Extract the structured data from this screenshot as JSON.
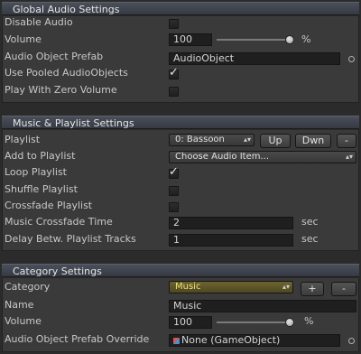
{
  "global": {
    "title": "Global Audio Settings",
    "disable_audio_label": "Disable Audio",
    "disable_audio_checked": false,
    "volume_label": "Volume",
    "volume_value": "100",
    "volume_level": 1.0,
    "volume_unit": "%",
    "prefab_label": "Audio Object Prefab",
    "prefab_value": "AudioObject",
    "pooled_label": "Use Pooled AudioObjects",
    "pooled_checked": true,
    "zero_volume_label": "Play With Zero Volume",
    "zero_volume_checked": false
  },
  "music": {
    "title": "Music & Playlist Settings",
    "playlist_label": "Playlist",
    "playlist_selected": "0: Bassoon",
    "up_label": "Up",
    "down_label": "Dwn",
    "remove_label": "-",
    "add_label": "Add to Playlist",
    "add_selected": "Choose Audio Item...",
    "loop_label": "Loop Playlist",
    "loop_checked": true,
    "shuffle_label": "Shuffle Playlist",
    "shuffle_checked": false,
    "crossfade_label": "Crossfade Playlist",
    "crossfade_checked": false,
    "crossfade_time_label": "Music Crossfade Time",
    "crossfade_time_value": "2",
    "crossfade_time_unit": "sec",
    "delay_label": "Delay Betw. Playlist Tracks",
    "delay_value": "1",
    "delay_unit": "sec"
  },
  "category": {
    "title": "Category Settings",
    "category_label": "Category",
    "category_selected": "Music",
    "add_label": "+",
    "remove_label": "-",
    "name_label": "Name",
    "name_value": "Music",
    "volume_label": "Volume",
    "volume_value": "100",
    "volume_level": 1.0,
    "volume_unit": "%",
    "prefab_override_label": "Audio Object Prefab Override",
    "prefab_override_value": "None (GameObject)"
  },
  "icons": {
    "check": "checkmark-icon",
    "dropdown": "dropdown-arrow-icon",
    "object_picker": "object-picker-icon",
    "gameobject": "gameobject-icon"
  },
  "colors": {
    "panel_bg": "#3a3a3a",
    "header_bg": "#3e434d",
    "selected_category": "#c9b233"
  }
}
